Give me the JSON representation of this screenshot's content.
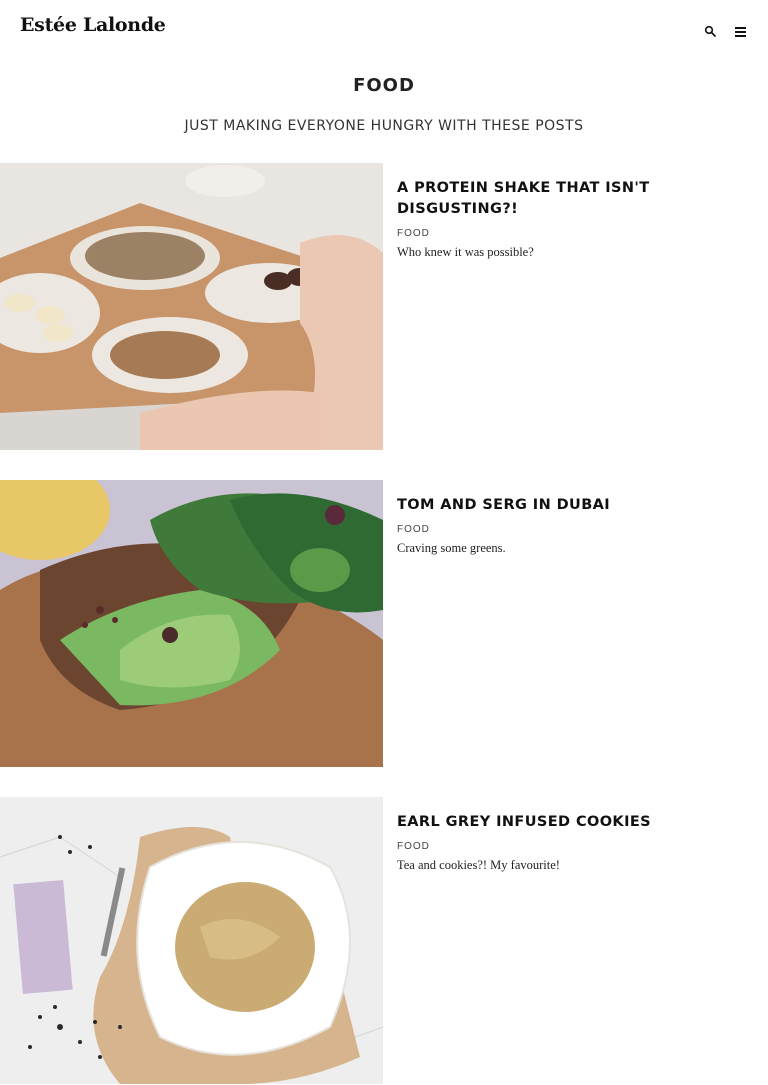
{
  "site": {
    "logo": "Estée Lalonde"
  },
  "header": {
    "search_icon": "search-icon",
    "menu_icon": "hamburger-menu-icon"
  },
  "page": {
    "title": "FOOD",
    "subtitle": "JUST MAKING EVERYONE HUNGRY WITH THESE POSTS"
  },
  "posts": [
    {
      "title": "A PROTEIN SHAKE THAT ISN'T DISGUSTING?!",
      "category": "FOOD",
      "excerpt": "Who knew it was possible?"
    },
    {
      "title": "TOM AND SERG IN DUBAI",
      "category": "FOOD",
      "excerpt": "Craving some greens."
    },
    {
      "title": "EARL GREY INFUSED COOKIES",
      "category": "FOOD",
      "excerpt": "Tea and cookies?! My favourite!"
    }
  ]
}
